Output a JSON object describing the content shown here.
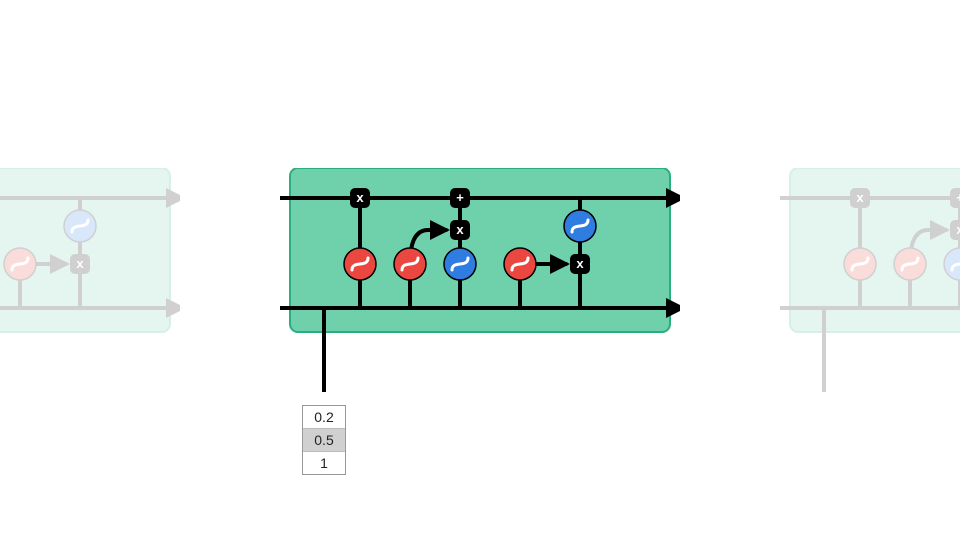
{
  "diagram": {
    "type": "lstm-cell",
    "ops": {
      "mult": "x",
      "add": "+"
    },
    "gates": {
      "forget": {
        "activation": "sigmoid",
        "color": "#e9473f"
      },
      "input": {
        "activation": "sigmoid",
        "color": "#e9473f"
      },
      "candidate": {
        "activation": "tanh",
        "color": "#2f7de1"
      },
      "output": {
        "activation": "sigmoid",
        "color": "#e9473f"
      },
      "state_act": {
        "activation": "tanh",
        "color": "#2f7de1"
      }
    },
    "cell_bg": "#6fd1ab",
    "cell_border": "#2aae7f"
  },
  "input_values": {
    "options": [
      "0.2",
      "0.5",
      "1"
    ],
    "selected_index": 1
  }
}
